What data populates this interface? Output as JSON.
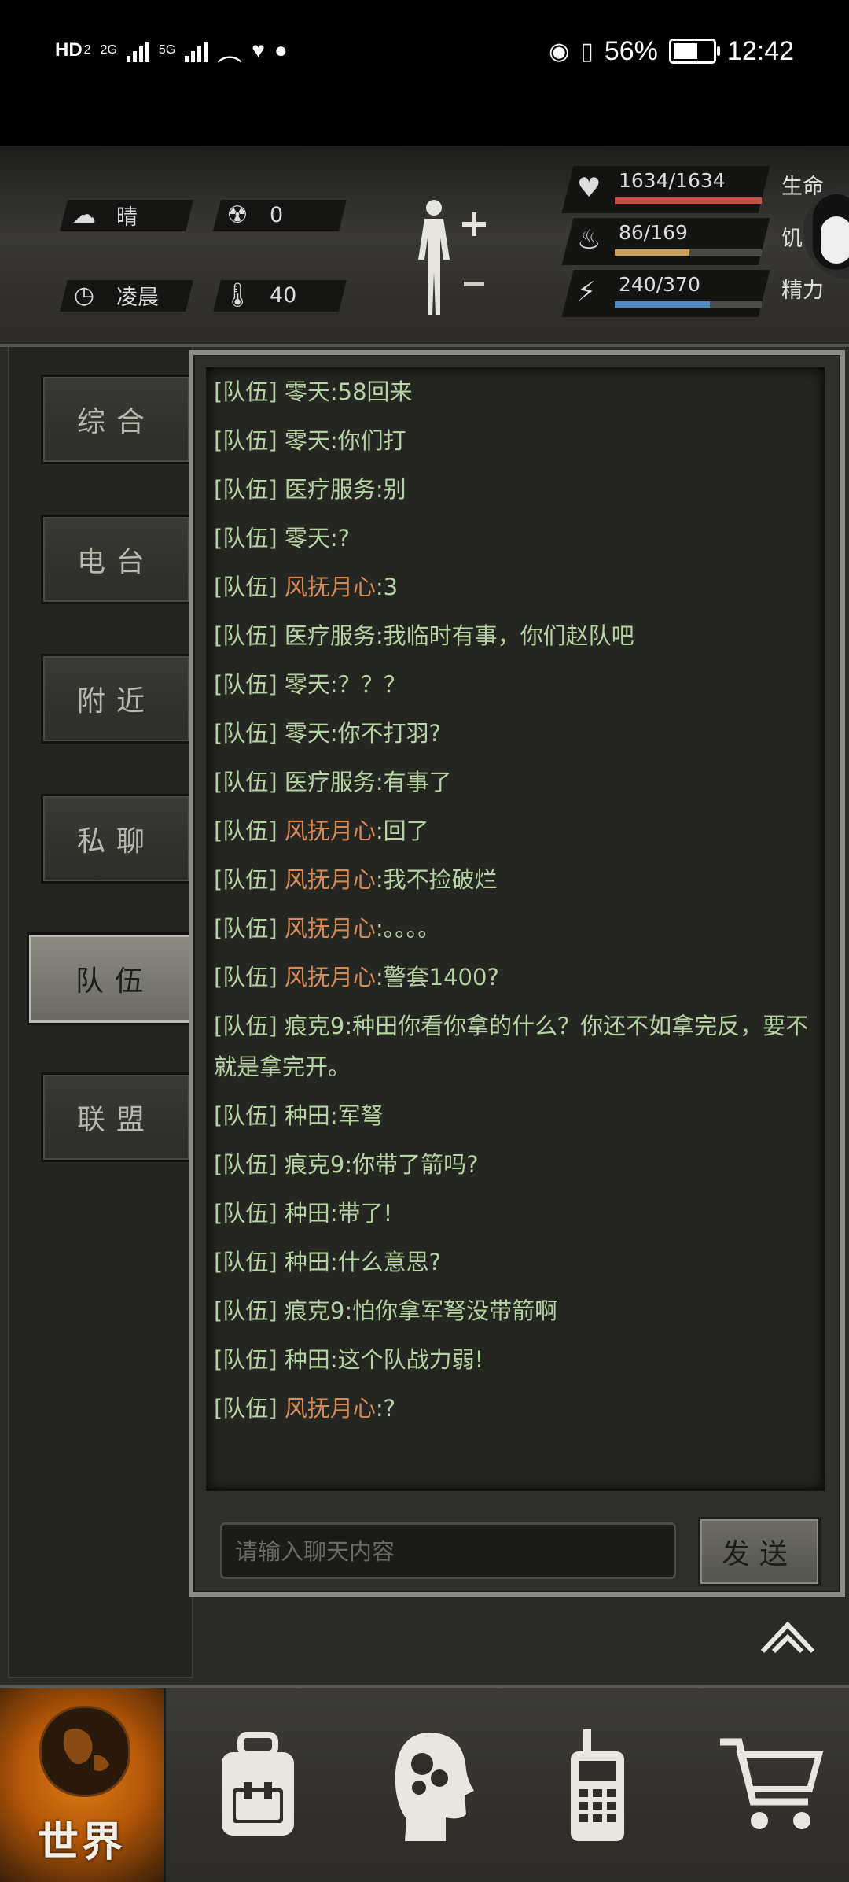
{
  "status_bar": {
    "left_tags": [
      "HD",
      "2",
      "2G",
      "5G"
    ],
    "battery": "56%",
    "time": "12:42"
  },
  "hud": {
    "weather": "晴",
    "radiation": "0",
    "time_of_day": "凌晨",
    "temperature": "40",
    "stats": [
      {
        "label": "生命",
        "value": "1634/1634",
        "fill": 1.0,
        "color": "#c8504a",
        "icon": "heart-pulse-icon"
      },
      {
        "label": "饥饿",
        "value": "86/169",
        "fill": 0.509,
        "color": "#c9a25a",
        "icon": "stomach-icon"
      },
      {
        "label": "精力",
        "value": "240/370",
        "fill": 0.649,
        "color": "#4f8dc4",
        "icon": "head-bolt-icon"
      }
    ]
  },
  "tabs": [
    {
      "label": "综合",
      "active": false
    },
    {
      "label": "电台",
      "active": false
    },
    {
      "label": "附近",
      "active": false
    },
    {
      "label": "私聊",
      "active": false
    },
    {
      "label": "队伍",
      "active": true
    },
    {
      "label": "联盟",
      "active": false
    }
  ],
  "chat": {
    "messages": [
      {
        "channel": "[队伍]",
        "name": "零天",
        "name_color": "green",
        "text": ":58回来"
      },
      {
        "channel": "[队伍]",
        "name": "零天",
        "name_color": "green",
        "text": ":你们打"
      },
      {
        "channel": "[队伍]",
        "name": "医疗服务",
        "name_color": "green",
        "text": ":别"
      },
      {
        "channel": "[队伍]",
        "name": "零天",
        "name_color": "green",
        "text": ":?"
      },
      {
        "channel": "[队伍]",
        "name": "风抚月心",
        "name_color": "orange",
        "text": ":3"
      },
      {
        "channel": "[队伍]",
        "name": "医疗服务",
        "name_color": "green",
        "text": ":我临时有事，你们赵队吧"
      },
      {
        "channel": "[队伍]",
        "name": "零天",
        "name_color": "green",
        "text": ":？？？"
      },
      {
        "channel": "[队伍]",
        "name": "零天",
        "name_color": "green",
        "text": ":你不打羽?"
      },
      {
        "channel": "[队伍]",
        "name": "医疗服务",
        "name_color": "green",
        "text": ":有事了"
      },
      {
        "channel": "[队伍]",
        "name": "风抚月心",
        "name_color": "orange",
        "text": ":回了"
      },
      {
        "channel": "[队伍]",
        "name": "风抚月心",
        "name_color": "orange",
        "text": ":我不捡破烂"
      },
      {
        "channel": "[队伍]",
        "name": "风抚月心",
        "name_color": "orange",
        "text": ":。。。。"
      },
      {
        "channel": "[队伍]",
        "name": "风抚月心",
        "name_color": "orange",
        "text": ":警套1400?"
      },
      {
        "channel": "[队伍]",
        "name": "痕克9",
        "name_color": "green",
        "text": ":种田你看你拿的什么？你还不如拿完反，要不就是拿完开。"
      },
      {
        "channel": "[队伍]",
        "name": "种田",
        "name_color": "green",
        "text": ":军弩"
      },
      {
        "channel": "[队伍]",
        "name": "痕克9",
        "name_color": "green",
        "text": ":你带了箭吗?"
      },
      {
        "channel": "[队伍]",
        "name": "种田",
        "name_color": "green",
        "text": ":带了!"
      },
      {
        "channel": "[队伍]",
        "name": "种田",
        "name_color": "green",
        "text": ":什么意思?"
      },
      {
        "channel": "[队伍]",
        "name": "痕克9",
        "name_color": "green",
        "text": ":怕你拿军弩没带箭啊"
      },
      {
        "channel": "[队伍]",
        "name": "种田",
        "name_color": "green",
        "text": ":这个队战力弱!"
      },
      {
        "channel": "[队伍]",
        "name": "风抚月心",
        "name_color": "orange",
        "text": ":?"
      }
    ],
    "input_placeholder": "请输入聊天内容",
    "send_label": "发送"
  },
  "bottom_nav": {
    "world_label": "世界",
    "items": [
      "world-globe-icon",
      "backpack-icon",
      "skills-head-icon",
      "walkie-talkie-icon",
      "shopping-cart-icon"
    ]
  }
}
